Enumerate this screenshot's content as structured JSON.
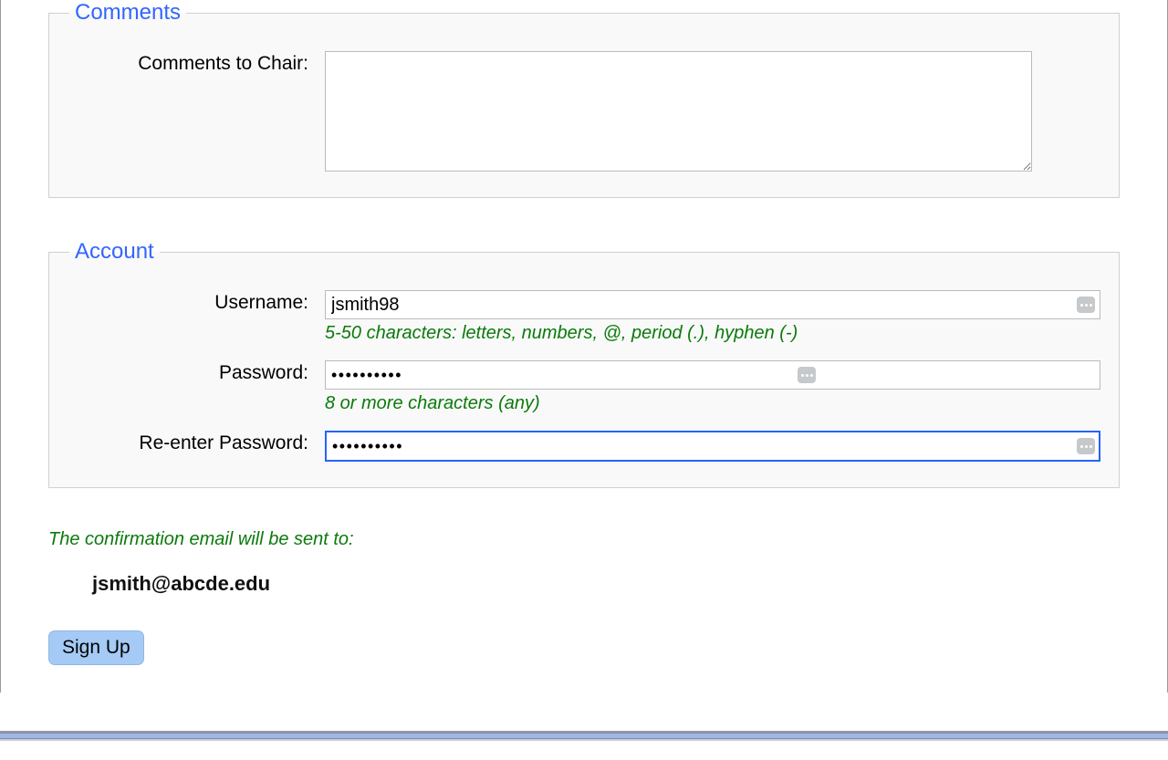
{
  "comments": {
    "legend": "Comments",
    "chair_label": "Comments to Chair:",
    "chair_value": ""
  },
  "account": {
    "legend": "Account",
    "username_label": "Username:",
    "username_value": "jsmith98",
    "username_hint": "5-50 characters: letters, numbers, @, period (.), hyphen (-)",
    "password_label": "Password:",
    "password_value": "••••••••••",
    "password_hint": "8 or more characters (any)",
    "reenter_label": "Re-enter Password:",
    "reenter_value": "••••••••••"
  },
  "confirmation": {
    "text": "The confirmation email will be sent to:",
    "email": "jsmith@abcde.edu"
  },
  "actions": {
    "signup_label": "Sign Up"
  }
}
